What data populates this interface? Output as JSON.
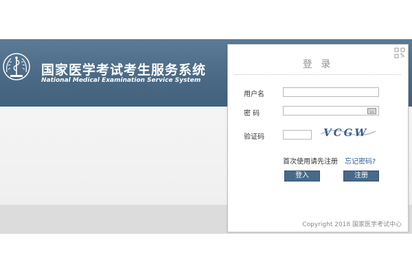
{
  "header": {
    "title_cn": "国家医学考试考生服务系统",
    "title_en": "National Medical Examination Service System",
    "logo_icon": "caduceus-emblem-icon"
  },
  "login": {
    "title": "登 录",
    "username_label": "用户名",
    "username_value": "",
    "password_label": "密 码",
    "password_value": "",
    "keyboard_icon": "keyboard-icon",
    "captcha_label": "验证码",
    "captcha_value": "",
    "captcha_text": "VCGW",
    "first_use_text": "首次使用请先注册",
    "forgot_password": "忘记密码?",
    "login_button": "登入",
    "register_button": "注册",
    "corner_icon": "qr-corner-icon"
  },
  "footer": {
    "copyright": "Copyright 2018 国家医学考试中心"
  },
  "colors": {
    "banner": "#4a6a86",
    "button": "#48698a",
    "link": "#2f5e8e",
    "background_gray": "#f0f0f0"
  }
}
